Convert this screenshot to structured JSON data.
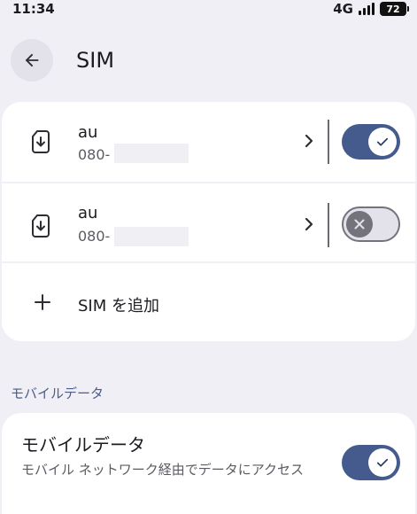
{
  "status_bar": {
    "time": "11:34",
    "network": "4G",
    "battery": "72"
  },
  "header": {
    "title": "SIM",
    "back_icon": "arrow-left-icon"
  },
  "sims": [
    {
      "name": "au",
      "number_prefix": "080-",
      "enabled": true
    },
    {
      "name": "au",
      "number_prefix": "080-",
      "enabled": false
    }
  ],
  "add_sim": {
    "label": "SIM を追加"
  },
  "mobile_data_section": {
    "header": "モバイルデータ",
    "title": "モバイルデータ",
    "description": "モバイル ネットワーク経由でデータにアクセス",
    "enabled": true
  },
  "colors": {
    "accent": "#455a8d",
    "background": "#f0eff6",
    "card": "#ffffff",
    "section_header": "#4d5d87"
  }
}
